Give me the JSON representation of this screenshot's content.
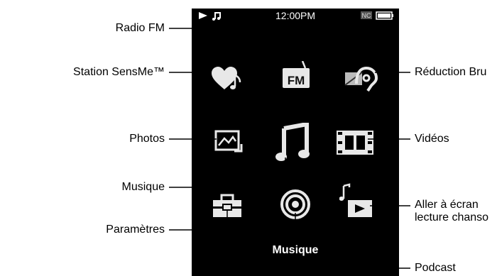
{
  "status_bar": {
    "play_icon": "play-icon",
    "note_icon": "music-note-icon",
    "time": "12:00PM",
    "noise_icon": "noise-cancel-status-icon",
    "battery_icon": "battery-icon"
  },
  "screen_title": "Musique",
  "menu_icons": [
    "heart-note-icon",
    "fm-radio-icon",
    "noise-cancel-icon",
    "photo-icon",
    "music-note-icon",
    "film-strip-icon",
    "toolbox-icon",
    "podcast-icon",
    "now-playing-icon"
  ],
  "labels": {
    "radio_fm": "Radio FM",
    "sensme": "Station SensMe™",
    "reduction": "Réduction Bru",
    "photos": "Photos",
    "videos": "Vidéos",
    "musique": "Musique",
    "parametres": "Paramètres",
    "aller_line1": "Aller à écran",
    "aller_line2": "lecture chanso",
    "podcast": "Podcast"
  },
  "colors": {
    "screen": "#000000",
    "icon": "#e8e8e8",
    "leader": "#000000"
  }
}
